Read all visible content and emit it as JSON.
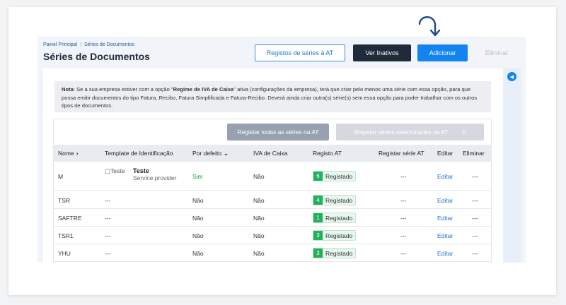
{
  "breadcrumb": {
    "home": "Painel Principal",
    "separator": "|",
    "current": "Séries de Documentos"
  },
  "page_title": "Séries de Documentos",
  "header_buttons": {
    "registos": "Registos de séries à AT",
    "inativos": "Ver Inativos",
    "adicionar": "Adicionar",
    "eliminar": "Eliminar"
  },
  "note": {
    "label": "Nota",
    "text_1": ": Se a sua empresa estiver com a opção \"",
    "option": "Regime de IVA de Caixa",
    "text_2": "\" ativa (configurações da empresa), terá que criar pelo menos uma série com essa opção, para que possa emitir documentos do tipo Fatura, Recibo, Fatura Simplificada e Fatura-Recibo. Deverá ainda criar outra(s) série(s) sem essa opção para poder trabalhar com os outros tipos de documentos."
  },
  "actions": {
    "register_all": "Registar todas as séries na AT",
    "register_selected": "Registar séries selecionadas na AT",
    "selected_count": "0"
  },
  "table": {
    "headers": {
      "nome": "Nome",
      "template": "Template de Identificação",
      "por_defeito": "Por defeito",
      "iva_caixa": "IVA de Caixa",
      "registo_at": "Registo AT",
      "registar_serie_at": "Registar série AT",
      "editar": "Editar",
      "eliminar": "Eliminar"
    },
    "rows": [
      {
        "nome": "M",
        "template_img_alt": "Teste",
        "template_name": "Teste",
        "template_sub": "Service provider",
        "por_defeito": "Sim",
        "iva_caixa": "Não",
        "registo_count": "6",
        "registo_status": "Registado",
        "registar": "---",
        "editar": "Editar",
        "eliminar": "---"
      },
      {
        "nome": "TSR",
        "template": "---",
        "por_defeito": "Não",
        "iva_caixa": "Não",
        "registo_count": "4",
        "registo_status": "Registado",
        "registar": "---",
        "editar": "Editar",
        "eliminar": "---"
      },
      {
        "nome": "SAFTRE",
        "template": "---",
        "por_defeito": "Não",
        "iva_caixa": "Não",
        "registo_count": "1",
        "registo_status": "Registado",
        "registar": "---",
        "editar": "Editar",
        "eliminar": "---"
      },
      {
        "nome": "TSR1",
        "template": "---",
        "por_defeito": "Não",
        "iva_caixa": "Não",
        "registo_count": "3",
        "registo_status": "Registado",
        "registar": "---",
        "editar": "Editar",
        "eliminar": "---"
      },
      {
        "nome": "YHU",
        "template": "---",
        "por_defeito": "Não",
        "iva_caixa": "Não",
        "registo_count": "3",
        "registo_status": "Registado",
        "registar": "---",
        "editar": "Editar",
        "eliminar": "---"
      }
    ]
  },
  "icons": {
    "sort": "chevron-right-icon",
    "sort_down": "chevron-down-icon",
    "rail": "chevron-left-circle-icon",
    "pointer": "curved-arrow-down-icon"
  },
  "colors": {
    "primary": "#1283f0",
    "dark": "#1f2a3a",
    "success": "#21b05c"
  }
}
